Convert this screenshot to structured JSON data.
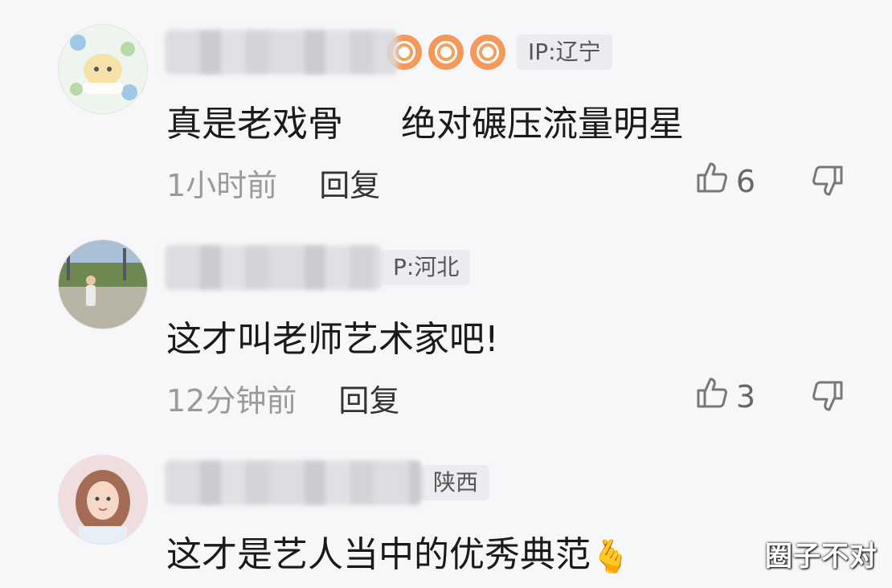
{
  "comments": [
    {
      "ip": "IP:辽宁",
      "text": "真是老戏骨 　 绝对碾压流量明星",
      "time": "1小时前",
      "reply": "回复",
      "likes": "6"
    },
    {
      "ip": "P:河北",
      "text": "这才叫老师艺术家吧!",
      "time": "12分钟前",
      "reply": "回复",
      "likes": "3"
    },
    {
      "ip": "陕西",
      "text": "这才是艺人当中的优秀典范",
      "emoji": "🫰"
    }
  ],
  "watermark": "圈子不对",
  "colors": {
    "background": "#f7f7f9",
    "medal": "#f4995a",
    "ip_badge": "#ececf0"
  },
  "icons": [
    "thumb-up-icon",
    "thumb-down-icon",
    "medal-icon"
  ]
}
